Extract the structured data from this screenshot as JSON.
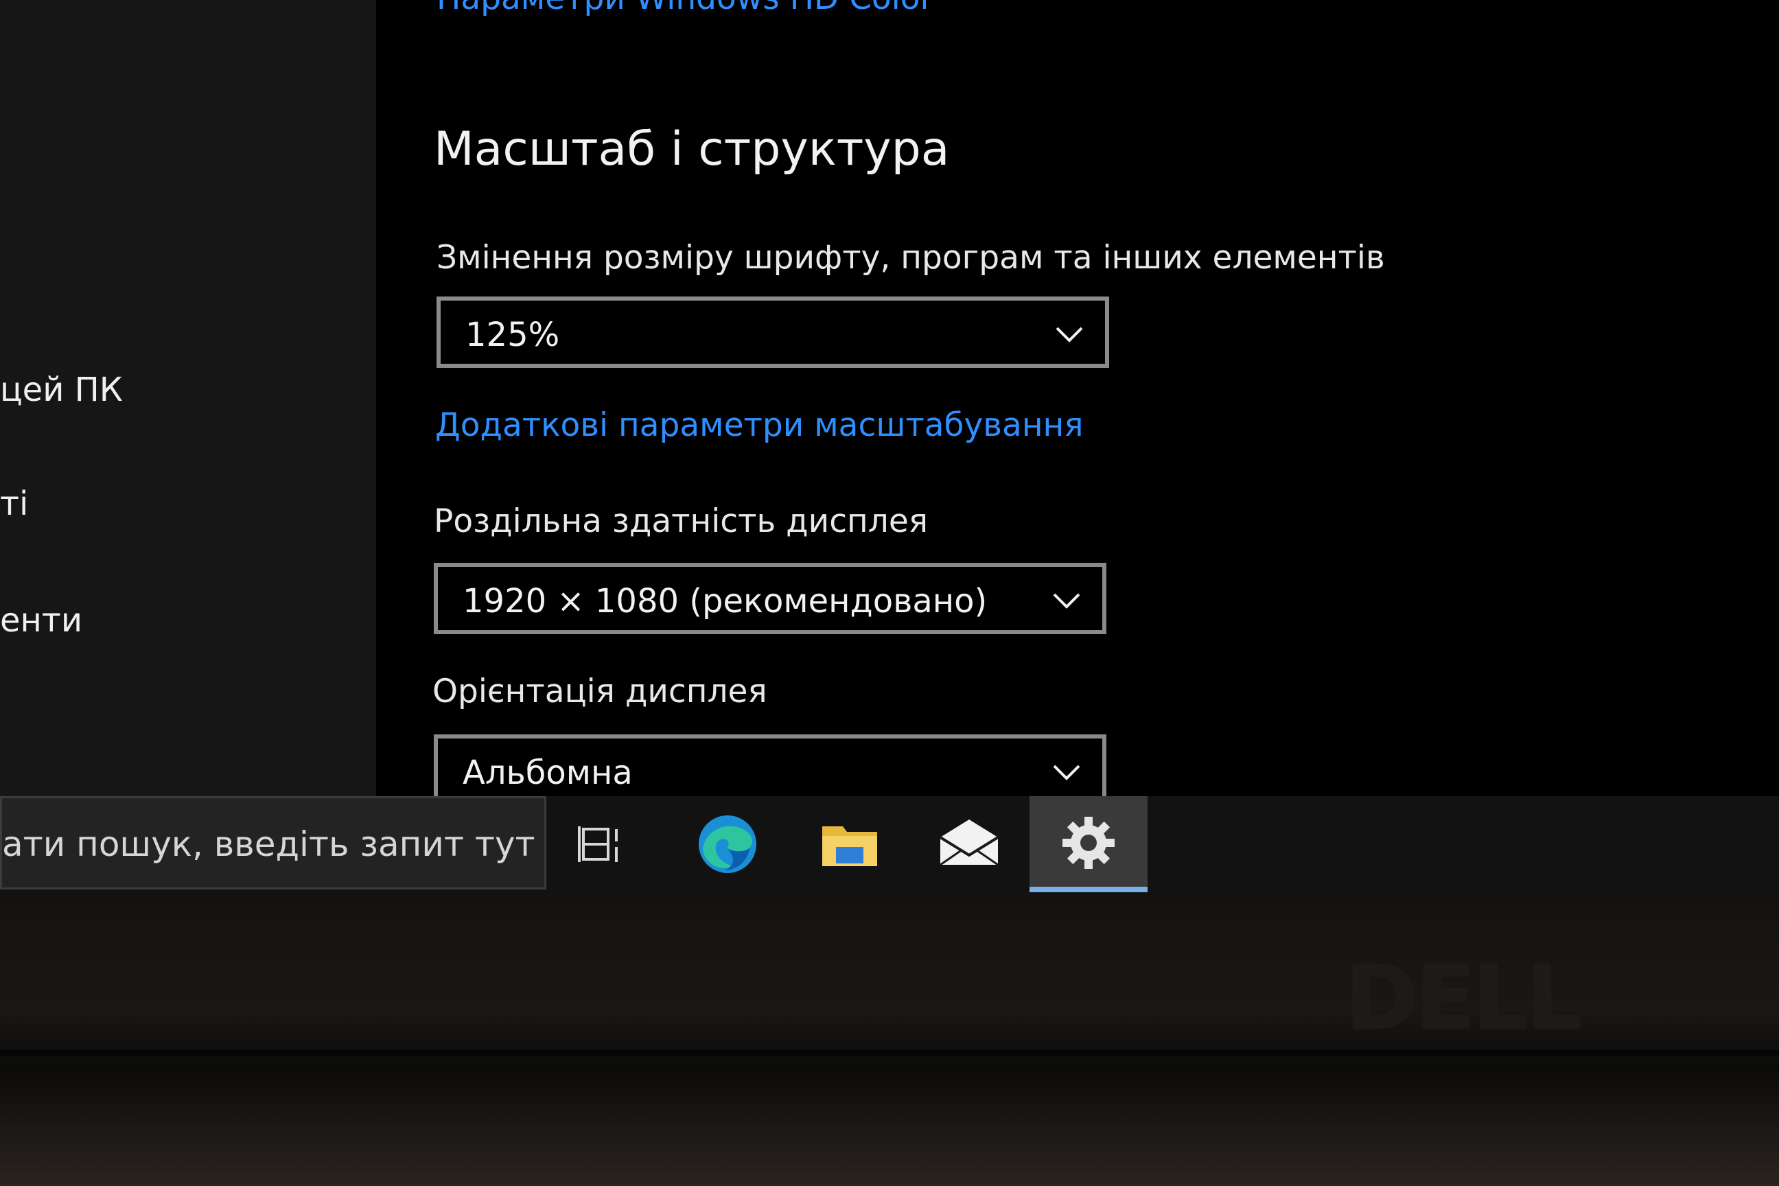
{
  "sidebar": {
    "items": [
      {
        "label": "цей ПК"
      },
      {
        "label": "ті"
      },
      {
        "label": "енти"
      }
    ]
  },
  "hdr_link": "Параметри Windows HD Color",
  "section": {
    "title": "Масштаб і структура"
  },
  "scale": {
    "label": "Змінення розміру шрифту, програм та інших елементів",
    "value": "125%",
    "advanced_link": "Додаткові параметри масштабування"
  },
  "resolution": {
    "label": "Роздільна здатність дисплея",
    "value": "1920 × 1080 (рекомендовано)"
  },
  "orientation": {
    "label": "Орієнтація дисплея",
    "value": "Альбомна"
  },
  "taskbar": {
    "search_text": "ати пошук, введіть запит тут",
    "icons": [
      "task-view-icon",
      "edge-icon",
      "file-explorer-icon",
      "mail-icon",
      "settings-icon"
    ]
  },
  "bezel": {
    "logo": "DELL"
  }
}
